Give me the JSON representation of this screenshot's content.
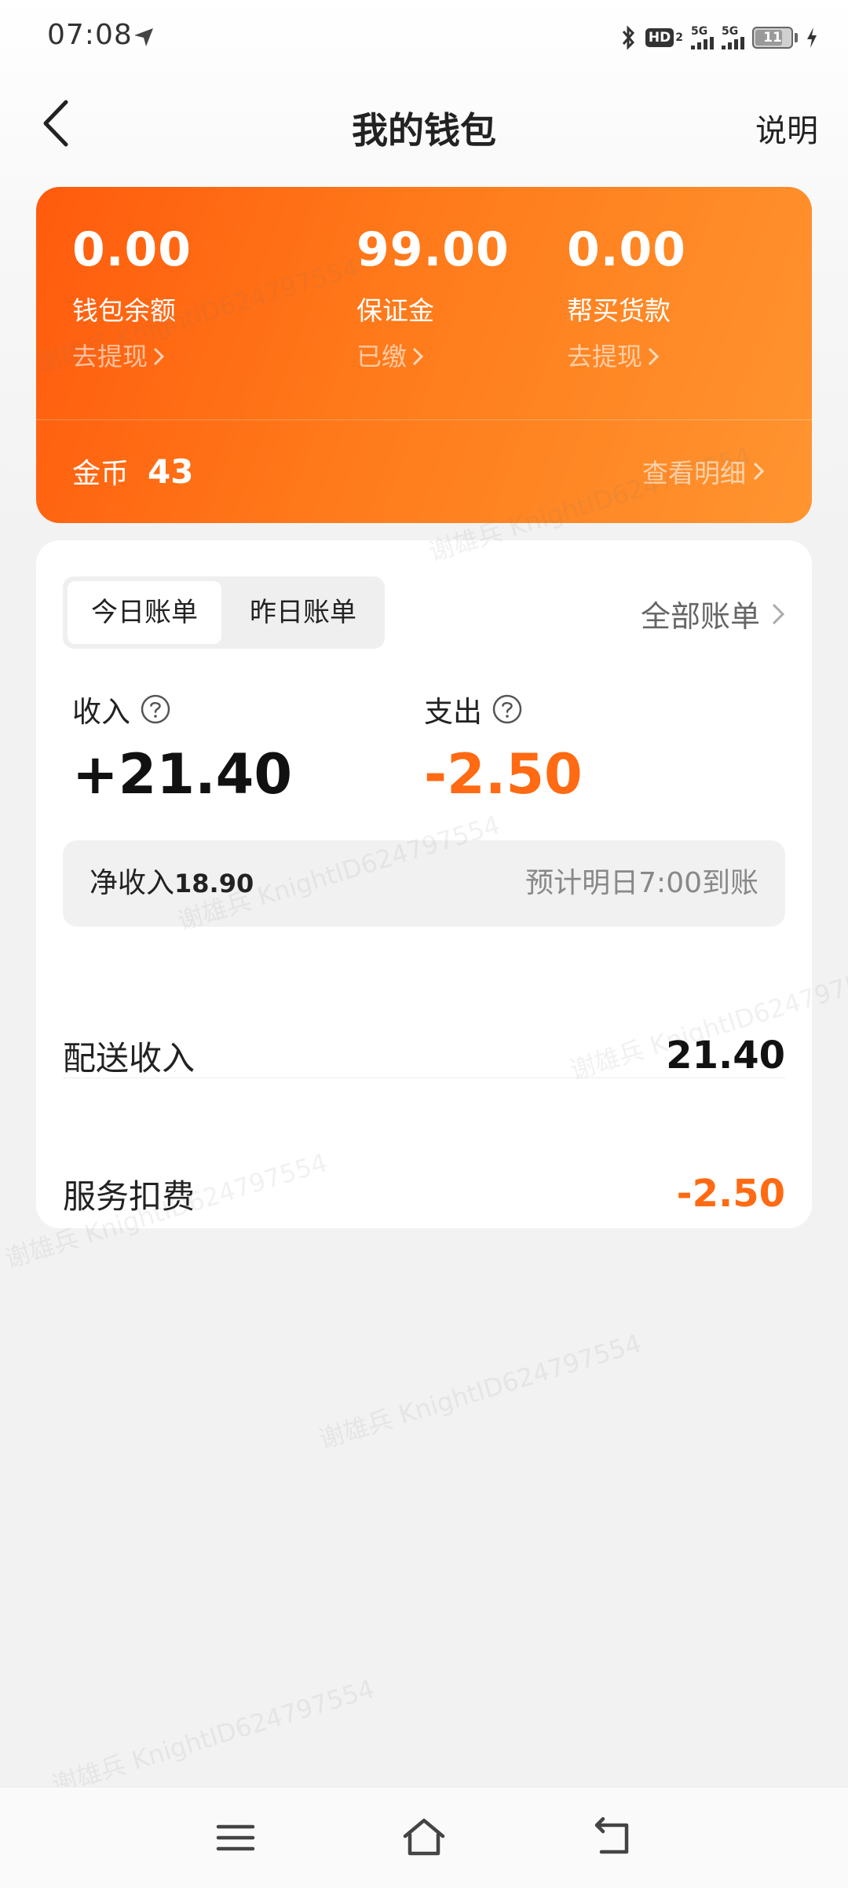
{
  "status_bar": {
    "time": "07:08",
    "hd_label": "HD",
    "hd_sub": "2",
    "sim1_label": "5G",
    "sim2_label": "5G",
    "battery_level": "11"
  },
  "header": {
    "title": "我的钱包",
    "explain_label": "说明"
  },
  "wallet": {
    "balances": [
      {
        "value": "0.00",
        "label": "钱包余额",
        "action": "去提现"
      },
      {
        "value": "99.00",
        "label": "保证金",
        "action": "已缴"
      },
      {
        "value": "0.00",
        "label": "帮买货款",
        "action": "去提现"
      }
    ],
    "coins_label": "金币",
    "coins_value": "43",
    "detail_label": "查看明细"
  },
  "bills": {
    "tabs": [
      {
        "label": "今日账单",
        "active": true
      },
      {
        "label": "昨日账单",
        "active": false
      }
    ],
    "all_bills_label": "全部账单",
    "income_label": "收入",
    "income_value": "+21.40",
    "expense_label": "支出",
    "expense_value": "-2.50",
    "net_label": "净收入",
    "net_value": "18.90",
    "arrival_note": "预计明日7:00到账",
    "items": [
      {
        "label": "配送收入",
        "value": "21.40"
      },
      {
        "label": "服务扣费",
        "value": "-2.50"
      }
    ]
  },
  "watermark": "谢雄兵 KnightID624797554",
  "colors": {
    "accent": "#ff6a13",
    "card_start": "#ff5b0d",
    "card_end": "#ff9530"
  }
}
